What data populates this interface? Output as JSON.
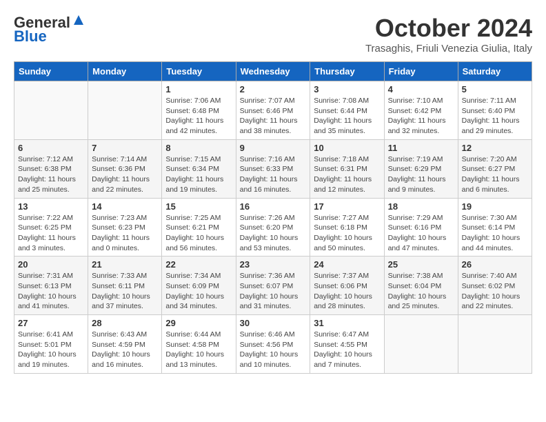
{
  "header": {
    "logo_general": "General",
    "logo_blue": "Blue",
    "month_title": "October 2024",
    "location": "Trasaghis, Friuli Venezia Giulia, Italy"
  },
  "weekdays": [
    "Sunday",
    "Monday",
    "Tuesday",
    "Wednesday",
    "Thursday",
    "Friday",
    "Saturday"
  ],
  "weeks": [
    [
      {
        "day": "",
        "sunrise": "",
        "sunset": "",
        "daylight": ""
      },
      {
        "day": "",
        "sunrise": "",
        "sunset": "",
        "daylight": ""
      },
      {
        "day": "1",
        "sunrise": "Sunrise: 7:06 AM",
        "sunset": "Sunset: 6:48 PM",
        "daylight": "Daylight: 11 hours and 42 minutes."
      },
      {
        "day": "2",
        "sunrise": "Sunrise: 7:07 AM",
        "sunset": "Sunset: 6:46 PM",
        "daylight": "Daylight: 11 hours and 38 minutes."
      },
      {
        "day": "3",
        "sunrise": "Sunrise: 7:08 AM",
        "sunset": "Sunset: 6:44 PM",
        "daylight": "Daylight: 11 hours and 35 minutes."
      },
      {
        "day": "4",
        "sunrise": "Sunrise: 7:10 AM",
        "sunset": "Sunset: 6:42 PM",
        "daylight": "Daylight: 11 hours and 32 minutes."
      },
      {
        "day": "5",
        "sunrise": "Sunrise: 7:11 AM",
        "sunset": "Sunset: 6:40 PM",
        "daylight": "Daylight: 11 hours and 29 minutes."
      }
    ],
    [
      {
        "day": "6",
        "sunrise": "Sunrise: 7:12 AM",
        "sunset": "Sunset: 6:38 PM",
        "daylight": "Daylight: 11 hours and 25 minutes."
      },
      {
        "day": "7",
        "sunrise": "Sunrise: 7:14 AM",
        "sunset": "Sunset: 6:36 PM",
        "daylight": "Daylight: 11 hours and 22 minutes."
      },
      {
        "day": "8",
        "sunrise": "Sunrise: 7:15 AM",
        "sunset": "Sunset: 6:34 PM",
        "daylight": "Daylight: 11 hours and 19 minutes."
      },
      {
        "day": "9",
        "sunrise": "Sunrise: 7:16 AM",
        "sunset": "Sunset: 6:33 PM",
        "daylight": "Daylight: 11 hours and 16 minutes."
      },
      {
        "day": "10",
        "sunrise": "Sunrise: 7:18 AM",
        "sunset": "Sunset: 6:31 PM",
        "daylight": "Daylight: 11 hours and 12 minutes."
      },
      {
        "day": "11",
        "sunrise": "Sunrise: 7:19 AM",
        "sunset": "Sunset: 6:29 PM",
        "daylight": "Daylight: 11 hours and 9 minutes."
      },
      {
        "day": "12",
        "sunrise": "Sunrise: 7:20 AM",
        "sunset": "Sunset: 6:27 PM",
        "daylight": "Daylight: 11 hours and 6 minutes."
      }
    ],
    [
      {
        "day": "13",
        "sunrise": "Sunrise: 7:22 AM",
        "sunset": "Sunset: 6:25 PM",
        "daylight": "Daylight: 11 hours and 3 minutes."
      },
      {
        "day": "14",
        "sunrise": "Sunrise: 7:23 AM",
        "sunset": "Sunset: 6:23 PM",
        "daylight": "Daylight: 11 hours and 0 minutes."
      },
      {
        "day": "15",
        "sunrise": "Sunrise: 7:25 AM",
        "sunset": "Sunset: 6:21 PM",
        "daylight": "Daylight: 10 hours and 56 minutes."
      },
      {
        "day": "16",
        "sunrise": "Sunrise: 7:26 AM",
        "sunset": "Sunset: 6:20 PM",
        "daylight": "Daylight: 10 hours and 53 minutes."
      },
      {
        "day": "17",
        "sunrise": "Sunrise: 7:27 AM",
        "sunset": "Sunset: 6:18 PM",
        "daylight": "Daylight: 10 hours and 50 minutes."
      },
      {
        "day": "18",
        "sunrise": "Sunrise: 7:29 AM",
        "sunset": "Sunset: 6:16 PM",
        "daylight": "Daylight: 10 hours and 47 minutes."
      },
      {
        "day": "19",
        "sunrise": "Sunrise: 7:30 AM",
        "sunset": "Sunset: 6:14 PM",
        "daylight": "Daylight: 10 hours and 44 minutes."
      }
    ],
    [
      {
        "day": "20",
        "sunrise": "Sunrise: 7:31 AM",
        "sunset": "Sunset: 6:13 PM",
        "daylight": "Daylight: 10 hours and 41 minutes."
      },
      {
        "day": "21",
        "sunrise": "Sunrise: 7:33 AM",
        "sunset": "Sunset: 6:11 PM",
        "daylight": "Daylight: 10 hours and 37 minutes."
      },
      {
        "day": "22",
        "sunrise": "Sunrise: 7:34 AM",
        "sunset": "Sunset: 6:09 PM",
        "daylight": "Daylight: 10 hours and 34 minutes."
      },
      {
        "day": "23",
        "sunrise": "Sunrise: 7:36 AM",
        "sunset": "Sunset: 6:07 PM",
        "daylight": "Daylight: 10 hours and 31 minutes."
      },
      {
        "day": "24",
        "sunrise": "Sunrise: 7:37 AM",
        "sunset": "Sunset: 6:06 PM",
        "daylight": "Daylight: 10 hours and 28 minutes."
      },
      {
        "day": "25",
        "sunrise": "Sunrise: 7:38 AM",
        "sunset": "Sunset: 6:04 PM",
        "daylight": "Daylight: 10 hours and 25 minutes."
      },
      {
        "day": "26",
        "sunrise": "Sunrise: 7:40 AM",
        "sunset": "Sunset: 6:02 PM",
        "daylight": "Daylight: 10 hours and 22 minutes."
      }
    ],
    [
      {
        "day": "27",
        "sunrise": "Sunrise: 6:41 AM",
        "sunset": "Sunset: 5:01 PM",
        "daylight": "Daylight: 10 hours and 19 minutes."
      },
      {
        "day": "28",
        "sunrise": "Sunrise: 6:43 AM",
        "sunset": "Sunset: 4:59 PM",
        "daylight": "Daylight: 10 hours and 16 minutes."
      },
      {
        "day": "29",
        "sunrise": "Sunrise: 6:44 AM",
        "sunset": "Sunset: 4:58 PM",
        "daylight": "Daylight: 10 hours and 13 minutes."
      },
      {
        "day": "30",
        "sunrise": "Sunrise: 6:46 AM",
        "sunset": "Sunset: 4:56 PM",
        "daylight": "Daylight: 10 hours and 10 minutes."
      },
      {
        "day": "31",
        "sunrise": "Sunrise: 6:47 AM",
        "sunset": "Sunset: 4:55 PM",
        "daylight": "Daylight: 10 hours and 7 minutes."
      },
      {
        "day": "",
        "sunrise": "",
        "sunset": "",
        "daylight": ""
      },
      {
        "day": "",
        "sunrise": "",
        "sunset": "",
        "daylight": ""
      }
    ]
  ]
}
